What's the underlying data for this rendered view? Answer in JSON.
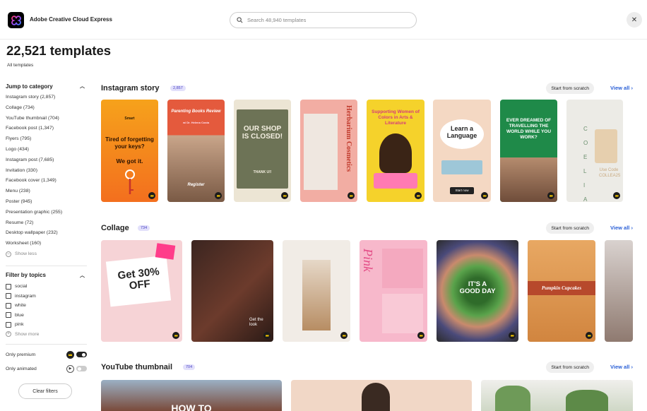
{
  "app": {
    "brand": "Adobe Creative Cloud Express"
  },
  "search": {
    "placeholder": "Search 48,940 templates"
  },
  "page": {
    "title": "22,521 templates",
    "breadcrumb": "All templates"
  },
  "sidebar": {
    "jump_title": "Jump to category",
    "categories": [
      "Instagram story (2,857)",
      "Collage (734)",
      "YouTube thumbnail (704)",
      "Facebook post (1,347)",
      "Flyers (795)",
      "Logo (434)",
      "Instagram post (7,685)",
      "Invitation (330)",
      "Facebook cover (1,349)",
      "Menu (238)",
      "Poster (945)",
      "Presentation graphic (255)",
      "Resume (72)",
      "Desktop wallpaper (232)",
      "Worksheet (160)"
    ],
    "show_less": "Show less",
    "topics_title": "Filter by topics",
    "topics": [
      "social",
      "instagram",
      "white",
      "blue",
      "pink"
    ],
    "show_more": "Show more",
    "only_premium": "Only premium",
    "only_animated": "Only animated",
    "clear_filters": "Clear filters"
  },
  "rows": [
    {
      "title": "Instagram story",
      "count": "2,857",
      "scratch": "Start from scratch",
      "view_all": "View all"
    },
    {
      "title": "Collage",
      "count": "734",
      "scratch": "Start from scratch",
      "view_all": "View all"
    },
    {
      "title": "YouTube thumbnail",
      "count": "704",
      "scratch": "Start from scratch",
      "view_all": "View all"
    }
  ],
  "cards": {
    "s1a": "Tired of forgetting your keys?",
    "s1b": "We got it.",
    "s2": "Parenting Books Review",
    "s2b": "Register",
    "s3": "OUR SHOP IS CLOSED!",
    "s3b": "THANK U!!",
    "s4": "Herbarium Cosmetics",
    "s5": "Supporting Women of Colors in Arts & Literature",
    "s6": "Learn a Language",
    "s6b": "Start now",
    "s7": "EVER DREAMED OF TRAVELLING THE WORLD WHILE YOU WORK?",
    "s8": "C O E L I A",
    "s8b": "Use Code COLLEA25",
    "c1": "Get 30% OFF",
    "c2": "Get the look",
    "c5": "IT'S A GOOD DAY",
    "c6": "Pumpkin Cupcakes",
    "c4": "Pink",
    "y1": "HOW TO"
  },
  "colors": {
    "accent": "#2a5fd6",
    "badge_bg": "#e2e0fb",
    "badge_fg": "#4b44c4"
  }
}
